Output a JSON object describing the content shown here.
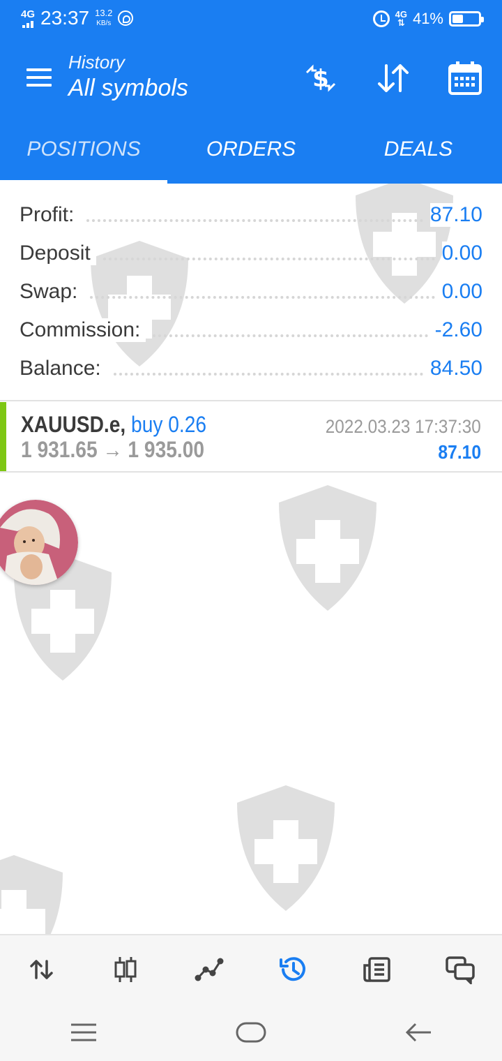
{
  "status_bar": {
    "network": "4G",
    "time": "23:37",
    "speed_value": "13.2",
    "speed_unit": "KB/s",
    "network_right": "4G",
    "battery": "41%",
    "battery_level": 0.41
  },
  "header": {
    "subtitle": "History",
    "title": "All symbols",
    "icons": [
      "menu-icon",
      "currency-exchange-icon",
      "sort-icon",
      "calendar-icon"
    ]
  },
  "tabs": [
    {
      "label": "POSITIONS",
      "active": true
    },
    {
      "label": "ORDERS",
      "active": false
    },
    {
      "label": "DEALS",
      "active": false
    }
  ],
  "summary": [
    {
      "label": "Profit:",
      "value": "87.10"
    },
    {
      "label": "Deposit",
      "value": "0.00"
    },
    {
      "label": "Swap:",
      "value": "0.00"
    },
    {
      "label": "Commission:",
      "value": "-2.60"
    },
    {
      "label": "Balance:",
      "value": "84.50"
    }
  ],
  "positions": [
    {
      "symbol": "XAUUSD.e,",
      "side": "buy 0.26",
      "open_price": "1 931.65",
      "arrow": "→",
      "close_price": "1 935.00",
      "datetime": "2022.03.23 17:37:30",
      "profit": "87.10"
    }
  ],
  "bottom_nav": [
    "quotes-icon",
    "chart-icon",
    "trade-icon",
    "history-icon",
    "news-icon",
    "messages-icon"
  ],
  "system_nav": [
    "recent-apps-icon",
    "home-icon",
    "back-icon"
  ],
  "colors": {
    "accent": "#1a7ef2",
    "buy_bar": "#7ec714",
    "text": "#3a3a3a",
    "muted": "#9a9a9a"
  }
}
